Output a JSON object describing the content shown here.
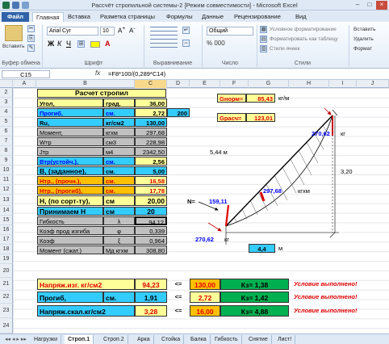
{
  "window": {
    "title": "Рассчёт стропильной системы-2 [Режим совместимости] - Microsoft Excel"
  },
  "ribbon_tabs": [
    "Файл",
    "Главная",
    "Вставка",
    "Разметка страницы",
    "Формулы",
    "Данные",
    "Рецензирование",
    "Вид"
  ],
  "ribbon": {
    "paste": "Вставить",
    "font_name": "Arial Cyr",
    "font_size": "10",
    "groups": [
      "Буфер обмена",
      "Шрифт",
      "Выравнивание",
      "Число",
      "Стили"
    ],
    "number_format": "Общий",
    "cond_format": "Условное форматирование",
    "format_table": "Форматировать как таблицу",
    "cell_styles": "Стили ячеек",
    "insert": "Вставить",
    "delete": "Удалить",
    "format": "Формат"
  },
  "formula_bar": {
    "name_box": "C15",
    "fx": "fx",
    "formula": "=F8*100/(0,289*C14)"
  },
  "columns": [
    "A",
    "B",
    "C",
    "D",
    "E",
    "F",
    "G",
    "H",
    "I",
    "J"
  ],
  "rows": [
    "2",
    "3",
    "4",
    "5",
    "6",
    "7",
    "8",
    "9",
    "10",
    "11",
    "12",
    "13",
    "14",
    "15",
    "16",
    "17",
    "18",
    "19",
    "20",
    "21",
    "22",
    "23",
    "24"
  ],
  "table": {
    "title": "Расчет стропил",
    "rows": [
      {
        "label": "Угол,",
        "unit": "град.",
        "value": "36,00"
      },
      {
        "label": "Прогиб,",
        "unit": "см.",
        "value": "2,72",
        "extra": "200"
      },
      {
        "label": "Ru,",
        "unit": "кг/см2",
        "value": "130,00"
      },
      {
        "label": "Момент,",
        "unit": "кгхм",
        "value": "297,68"
      },
      {
        "label": "Wтр",
        "unit": "см3",
        "value": "228,98"
      },
      {
        "label": "Jтр",
        "unit": "м4",
        "value": "2342,50"
      },
      {
        "label": "Втр(устойч.),",
        "unit": "см.",
        "value": "2,56"
      },
      {
        "label": "В, (заданное),",
        "unit": "см.",
        "value": "5,00"
      },
      {
        "label": "Нтр., (прочн.),",
        "unit": "см.",
        "value": "16,58"
      },
      {
        "label": "Нтр., (прогиб),",
        "unit": "см.",
        "value": "17,78"
      },
      {
        "label": "Н, (по сорт-ту),",
        "unit": "см",
        "value": "20,00"
      },
      {
        "label": "Принимаем Н",
        "unit": "см",
        "value": "20"
      },
      {
        "label": "Гибкость",
        "unit": "λ",
        "value": "94,12"
      },
      {
        "label": "Коэф прод изгиба",
        "unit": "φ",
        "value": "0,339"
      },
      {
        "label": "Коэф",
        "unit": "ξ",
        "value": "0,964"
      },
      {
        "label": "Момент (сжат.)",
        "unit": "Мд  кгхм",
        "value": "308,80"
      }
    ]
  },
  "checks": [
    {
      "label": "Напряж.изг.  кг/см2",
      "value": "94,23",
      "op": "<=",
      "limit": "130,00",
      "k": "Кз=  1,38",
      "status": "Условие выполнено!"
    },
    {
      "label": "Прогиб,",
      "unit": "см.",
      "value": "1,91",
      "op": "<=",
      "limit": "2,72",
      "k": "Кз=  1,42",
      "status": "Условие выполнено!"
    },
    {
      "label": "Напряж.скал.кг/см2",
      "value": "3,28",
      "op": "<=",
      "limit": "16,00",
      "k": "Кз=  4,88",
      "status": "Условие выполнено!"
    }
  ],
  "loads": {
    "gnorm_label": "Gнорм=",
    "gnorm": "85,43",
    "gnorm_unit": "кг/м",
    "gcalc_label": "Gрасч=",
    "gcalc": "123,01"
  },
  "diagram": {
    "top_force": "270,62",
    "top_unit": "кг",
    "length": "5,44 м",
    "n_label": "N=",
    "n_val": "159,11",
    "moment": "297,68",
    "moment_unit": "кгхм",
    "bottom_force": "270,62",
    "bottom_unit": "кг",
    "base": "4,4",
    "base_unit": "м",
    "height": "3,20"
  },
  "sheet_tabs": [
    "Нагрузки",
    "Строп.1",
    "Строп.2",
    "Арка",
    "Стойка",
    "Балка",
    "Гибкость",
    "Снятие",
    "Лист!"
  ]
}
